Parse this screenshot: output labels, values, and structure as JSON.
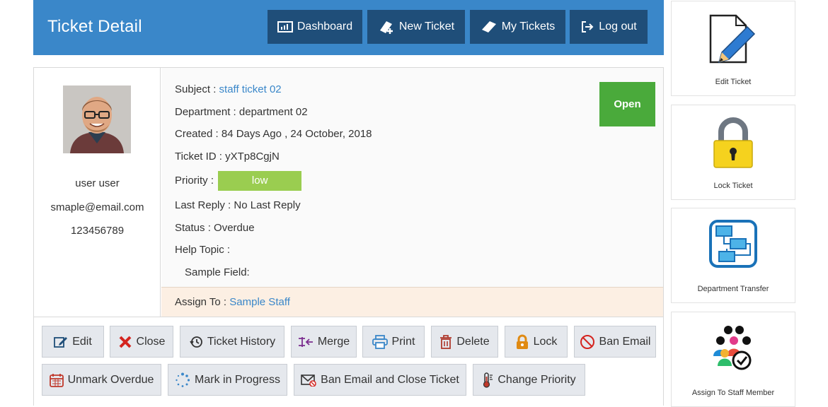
{
  "header": {
    "title": "Ticket Detail",
    "buttons": {
      "dashboard": "Dashboard",
      "new_ticket": "New Ticket",
      "my_tickets": "My Tickets",
      "logout": "Log out"
    }
  },
  "user": {
    "name": "user user",
    "email": "smaple@email.com",
    "phone": "123456789"
  },
  "ticket": {
    "subject_label": "Subject :",
    "subject_value": "staff ticket 02",
    "department_label": "Department :",
    "department_value": "department 02",
    "created_label": "Created :",
    "created_value": "84 Days Ago , 24 October, 2018",
    "id_label": "Ticket ID :",
    "id_value": "yXTp8CgjN",
    "priority_label": "Priority :",
    "priority_value": "low",
    "last_reply_label": "Last Reply :",
    "last_reply_value": "No Last Reply",
    "status_label": "Status :",
    "status_value": "Overdue",
    "help_topic_label": "Help Topic :",
    "sample_field_label": "Sample Field:",
    "state_badge": "Open",
    "assign_label": "Assign To :",
    "assign_value": "Sample Staff"
  },
  "actions": {
    "edit": "Edit",
    "close": "Close",
    "history": "Ticket History",
    "merge": "Merge",
    "print": "Print",
    "delete": "Delete",
    "lock": "Lock",
    "ban_email": "Ban Email",
    "unmark_overdue": "Unmark Overdue",
    "mark_progress": "Mark in Progress",
    "ban_close": "Ban Email and Close Ticket",
    "change_priority": "Change Priority"
  },
  "side_cards": {
    "edit_ticket": "Edit Ticket",
    "lock_ticket": "Lock Ticket",
    "dept_transfer": "Department Transfer",
    "assign_staff": "Assign To Staff Member"
  },
  "icons": {
    "dashboard": "dashboard-icon",
    "new_ticket": "new-ticket-icon",
    "my_tickets": "my-tickets-icon",
    "logout": "logout-icon"
  },
  "colors": {
    "header_bg": "#3a87c9",
    "header_button_bg": "#1f4e79",
    "link": "#3a87c9",
    "open_badge": "#4aaa3b",
    "priority_low": "#9acd50",
    "assign_bg": "#fcefe3"
  }
}
